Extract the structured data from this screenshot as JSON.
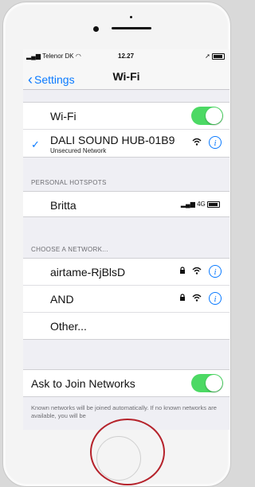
{
  "status": {
    "carrier": "Telenor DK",
    "time": "12.27"
  },
  "nav": {
    "back_label": "Settings",
    "title": "Wi-Fi"
  },
  "wifi": {
    "label": "Wi-Fi",
    "enabled": true
  },
  "connected": {
    "name": "DALI SOUND HUB-01B9",
    "subtitle": "Unsecured Network",
    "info_label": "i"
  },
  "hotspots": {
    "header": "PERSONAL HOTSPOTS",
    "items": [
      {
        "name": "Britta",
        "signal": "4G"
      }
    ]
  },
  "networks": {
    "header": "CHOOSE A NETWORK...",
    "items": [
      {
        "name": "airtame-RjBlsD"
      },
      {
        "name": "AND"
      },
      {
        "name": "Other..."
      }
    ]
  },
  "ask": {
    "label": "Ask to Join Networks",
    "enabled": true
  },
  "footer": {
    "text": "Known networks will be joined automatically. If no known networks are available, you will be"
  },
  "colors": {
    "accent": "#0a7aff",
    "toggle_on": "#4cd964",
    "annotation": "#b5222b"
  }
}
